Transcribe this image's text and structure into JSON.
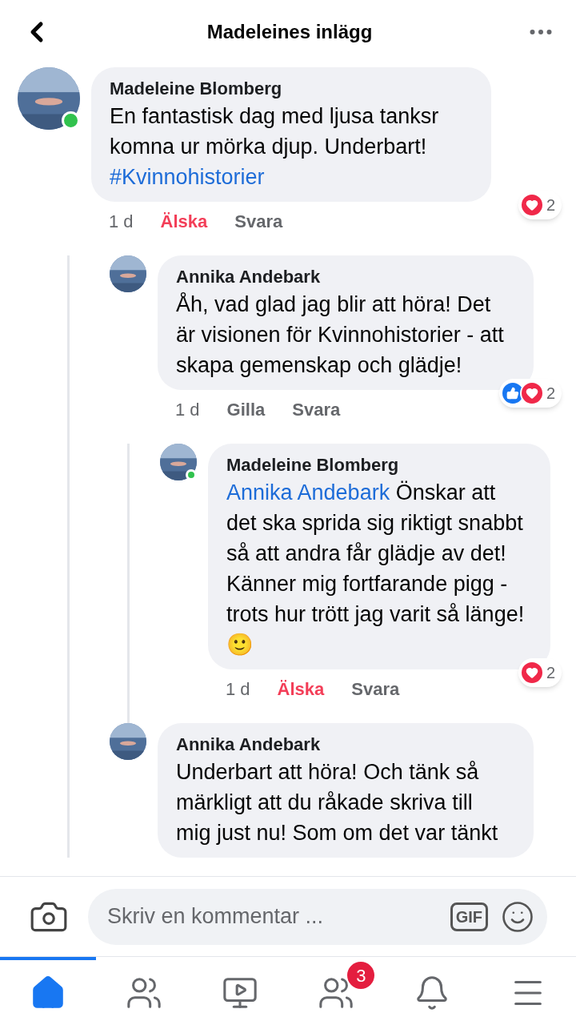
{
  "header": {
    "title": "Madeleines inlägg"
  },
  "comments": [
    {
      "author": "Madeleine Blomberg",
      "online": true,
      "text": "En fantastisk dag med ljusa tanksr komna ur mörka djup. Underbart!",
      "hashtag": "#Kvinnohistorier",
      "time": "1 d",
      "actions": [
        {
          "label": "Älska",
          "active": true
        },
        {
          "label": "Svara",
          "active": false
        }
      ],
      "reactions": {
        "items": [
          {
            "kind": "love"
          }
        ],
        "count": "2"
      },
      "children": [
        {
          "author": "Annika Andebark",
          "online": false,
          "text": "Åh, vad glad jag blir att höra! Det är visionen för Kvinnohistorier - att skapa gemenskap och glädje!",
          "time": "1 d",
          "actions": [
            {
              "label": "Gilla",
              "active": false
            },
            {
              "label": "Svara",
              "active": false
            }
          ],
          "reactions": {
            "items": [
              {
                "kind": "like"
              },
              {
                "kind": "love"
              }
            ],
            "count": "2"
          },
          "children": [
            {
              "author": "Madeleine Blomberg",
              "online": true,
              "mention": "Annika Andebark",
              "text": "Önskar att det ska sprida sig riktigt snabbt så att andra får glädje av det! Känner mig fortfarande pigg - trots hur trött jag varit så länge! 🙂",
              "time": "1 d",
              "actions": [
                {
                  "label": "Älska",
                  "active": true
                },
                {
                  "label": "Svara",
                  "active": false
                }
              ],
              "reactions": {
                "items": [
                  {
                    "kind": "love"
                  }
                ],
                "count": "2"
              }
            }
          ]
        },
        {
          "author": "Annika Andebark",
          "online": false,
          "text": "Underbart att höra! Och tänk så märkligt att du råkade skriva till mig just nu! Som om det var tänkt"
        }
      ]
    }
  ],
  "composer": {
    "placeholder": "Skriv en kommentar ...",
    "gif": "GIF"
  },
  "tabs": [
    {
      "kind": "home",
      "selected": true
    },
    {
      "kind": "friends",
      "selected": false
    },
    {
      "kind": "video",
      "selected": false
    },
    {
      "kind": "groups",
      "selected": false,
      "badge": "3"
    },
    {
      "kind": "bell",
      "selected": false
    },
    {
      "kind": "menu",
      "selected": false
    }
  ]
}
